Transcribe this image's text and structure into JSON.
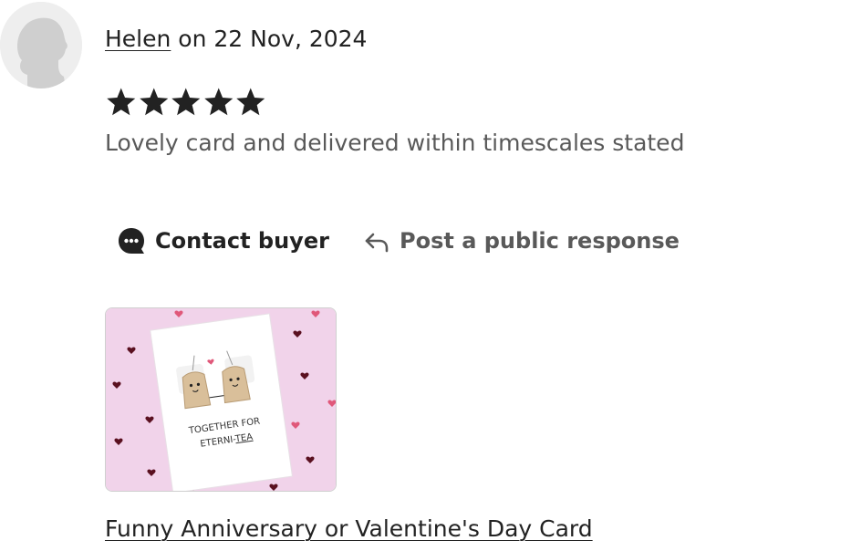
{
  "review": {
    "author": "Helen",
    "date_text": " on 22 Nov, 2024",
    "rating": 5,
    "max_rating": 5,
    "text": "Lovely card and delivered within timescales stated"
  },
  "actions": {
    "contact_label": "Contact buyer",
    "respond_label": "Post a public response"
  },
  "listing": {
    "title": "Funny Anniversary or Valentine's Day Card",
    "card_text_line1": "TOGETHER FOR",
    "card_text_line2_prefix": "ETERNI-",
    "card_text_line2_suffix": "TEA"
  },
  "colors": {
    "text": "#222222",
    "muted": "#595959",
    "thumb_bg": "#f1d3ea",
    "heart_dark": "#5a1020",
    "heart_pink": "#e0587a",
    "teabag": "#d9bf9a"
  },
  "icons": {
    "avatar": "user-avatar-icon",
    "star": "star-icon",
    "contact": "chat-bubble-icon",
    "respond": "reply-arrow-icon"
  }
}
